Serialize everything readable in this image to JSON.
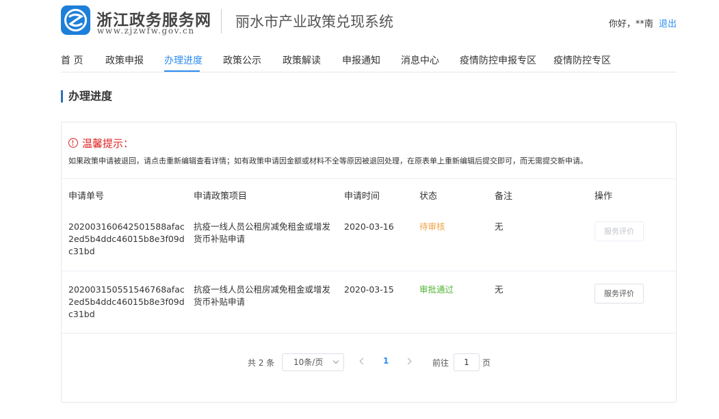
{
  "header": {
    "logo_text": "浙江政务服务网",
    "logo_url": "www.zjzwfw.gov.cn",
    "system_title": "丽水市产业政策兑现系统",
    "greeting": "你好，**南",
    "logout": "退出"
  },
  "nav": {
    "items": [
      {
        "label": "首 页"
      },
      {
        "label": "政策申报"
      },
      {
        "label": "办理进度",
        "active": true
      },
      {
        "label": "政策公示"
      },
      {
        "label": "政策解读"
      },
      {
        "label": "申报通知"
      },
      {
        "label": "消息中心"
      },
      {
        "label": "疫情防控申报专区"
      },
      {
        "label": "疫情防控专区"
      }
    ]
  },
  "section_title": "办理进度",
  "notice": {
    "title": "温馨提示：",
    "text": "如果政策申请被退回，请点击重新编辑查看详情；如有政策申请因金额或材料不全等原因被退回处理，在原表单上重新编辑后提交即可，而无需提交新申请。"
  },
  "table": {
    "headers": [
      "申请单号",
      "申请政策项目",
      "申请时间",
      "状态",
      "备注",
      "操作"
    ],
    "rows": [
      {
        "id": "202003160642501588afac2ed5b4ddc46015b8e3f09dc31bd",
        "project": "抗疫一线人员公租房减免租金或增发货币补贴申请",
        "date": "2020-03-16",
        "status": "待审核",
        "remark": "无",
        "action": "服务评价"
      },
      {
        "id": "202003150551546768afac2ed5b4ddc46015b8e3f09dc31bd",
        "project": "抗疫一线人员公租房减免租金或增发货币补贴申请",
        "date": "2020-03-15",
        "status": "审批通过",
        "remark": "无",
        "action": "服务评价"
      }
    ]
  },
  "pagination": {
    "total": "共 2 条",
    "page_size": "10条/页",
    "current": "1",
    "goto_label": "前往",
    "goto_value": "1",
    "page_label": "页"
  },
  "colors": {
    "accent": "#2d8cf0",
    "pending": "#f0a24a",
    "approved": "#52b535",
    "warning": "#e02020"
  }
}
